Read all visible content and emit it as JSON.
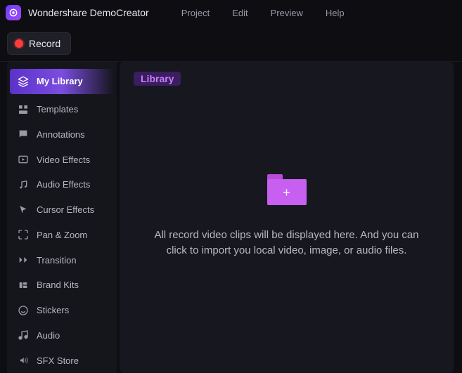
{
  "app": {
    "title": "Wondershare DemoCreator"
  },
  "menu": {
    "project": "Project",
    "edit": "Edit",
    "preview": "Preview",
    "help": "Help"
  },
  "toolbar": {
    "record": "Record"
  },
  "sidebar": {
    "items": [
      {
        "label": "My Library",
        "active": true
      },
      {
        "label": "Templates"
      },
      {
        "label": "Annotations"
      },
      {
        "label": "Video Effects"
      },
      {
        "label": "Audio Effects"
      },
      {
        "label": "Cursor Effects"
      },
      {
        "label": "Pan & Zoom"
      },
      {
        "label": "Transition"
      },
      {
        "label": "Brand Kits"
      },
      {
        "label": "Stickers"
      },
      {
        "label": "Audio"
      },
      {
        "label": "SFX Store"
      }
    ]
  },
  "main": {
    "tab_label": "Library",
    "empty_text": "All record video clips will be displayed here. And you can click to import you local video, image, or audio files."
  }
}
